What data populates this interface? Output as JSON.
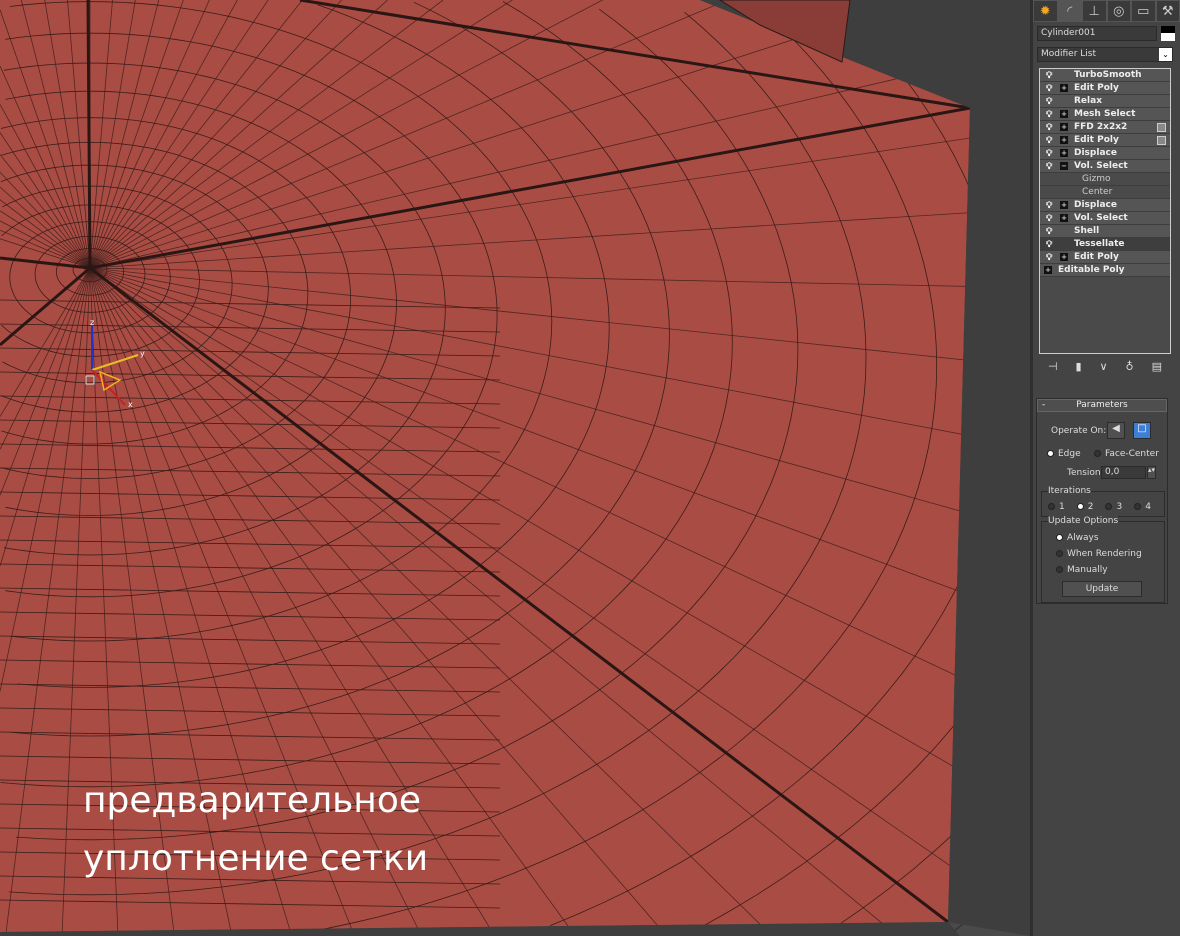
{
  "viewport": {
    "caption_line1": "предварительное",
    "caption_line2": "уплотнение сетки",
    "gizmo_axes": {
      "x": "x",
      "y": "y",
      "z": "z"
    },
    "mesh_color": "#a94c43"
  },
  "panel": {
    "tabs": [
      {
        "icon": "create-icon"
      },
      {
        "icon": "modify-icon"
      },
      {
        "icon": "hierarchy-icon"
      },
      {
        "icon": "motion-icon"
      },
      {
        "icon": "display-icon"
      },
      {
        "icon": "utilities-icon"
      }
    ],
    "object_name": "Cylinder001",
    "modifier_list": "Modifier List",
    "modifiers": [
      {
        "label": "TurboSmooth",
        "plus": false,
        "sq": false
      },
      {
        "label": "Edit Poly",
        "plus": true,
        "sq": false
      },
      {
        "label": "Relax",
        "plus": false,
        "sq": false
      },
      {
        "label": "Mesh Select",
        "plus": true,
        "sq": false
      },
      {
        "label": "FFD 2x2x2",
        "plus": true,
        "sq": true
      },
      {
        "label": "Edit Poly",
        "plus": true,
        "sq": true
      },
      {
        "label": "Displace",
        "plus": true,
        "sq": false
      },
      {
        "label": "Vol. Select",
        "plus": true,
        "sq": false,
        "expanded": true
      },
      {
        "label": "Gizmo",
        "sub": true
      },
      {
        "label": "Center",
        "sub": true
      },
      {
        "label": "Displace",
        "plus": true,
        "sq": false
      },
      {
        "label": "Vol. Select",
        "plus": true,
        "sq": false
      },
      {
        "label": "Shell",
        "plus": false,
        "sq": false
      },
      {
        "label": "Tessellate",
        "plus": false,
        "sq": false,
        "selected": true
      },
      {
        "label": "Edit Poly",
        "plus": true,
        "sq": false
      },
      {
        "label": "Editable Poly",
        "base": true
      }
    ],
    "params": {
      "title": "Parameters",
      "collapse": "-",
      "operate_on": "Operate On:",
      "edge": "Edge",
      "face_center": "Face-Center",
      "tension_label": "Tension:",
      "tension": "0,0",
      "iterations_label": "Iterations",
      "iterations": [
        "1",
        "2",
        "3",
        "4"
      ],
      "iteration_selected": "2",
      "update_options": "Update Options",
      "always": "Always",
      "when_rendering": "When Rendering",
      "manually": "Manually",
      "update": "Update"
    }
  }
}
